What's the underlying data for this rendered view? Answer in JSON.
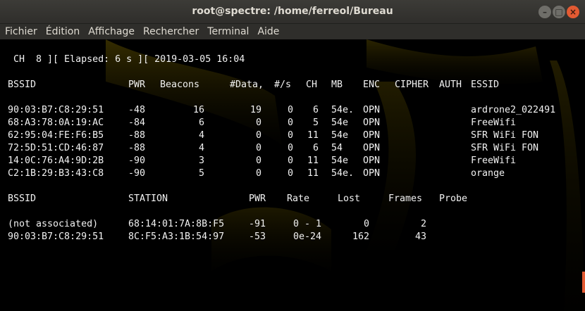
{
  "window": {
    "title": "root@spectre: /home/ferreol/Bureau",
    "buttons": {
      "minimize": "–",
      "maximize": "□",
      "close": "×"
    }
  },
  "menu": [
    "Fichier",
    "Édition",
    "Affichage",
    "Rechercher",
    "Terminal",
    "Aide"
  ],
  "terminal": {
    "status_line": " CH  8 ][ Elapsed: 6 s ][ 2019-03-05 16:04",
    "ap_headers": [
      "BSSID",
      "PWR",
      "Beacons",
      "#Data,",
      "#/s",
      "CH",
      "MB",
      "ENC",
      "CIPHER",
      "AUTH",
      "ESSID"
    ],
    "access_points": [
      {
        "bssid": "90:03:B7:C8:29:51",
        "pwr": "-48",
        "beacons": "16",
        "data": "19",
        "per_s": "0",
        "ch": "6",
        "mb": "54e.",
        "enc": "OPN",
        "cipher": "",
        "auth": "",
        "essid": "ardrone2_022491"
      },
      {
        "bssid": "68:A3:78:0A:19:AC",
        "pwr": "-84",
        "beacons": "6",
        "data": "0",
        "per_s": "0",
        "ch": "5",
        "mb": "54e",
        "enc": "OPN",
        "cipher": "",
        "auth": "",
        "essid": "FreeWifi"
      },
      {
        "bssid": "62:95:04:FE:F6:B5",
        "pwr": "-88",
        "beacons": "4",
        "data": "0",
        "per_s": "0",
        "ch": "11",
        "mb": "54e",
        "enc": "OPN",
        "cipher": "",
        "auth": "",
        "essid": "SFR WiFi FON"
      },
      {
        "bssid": "72:5D:51:CD:46:87",
        "pwr": "-88",
        "beacons": "4",
        "data": "0",
        "per_s": "0",
        "ch": "6",
        "mb": "54",
        "enc": "OPN",
        "cipher": "",
        "auth": "",
        "essid": "SFR WiFi FON"
      },
      {
        "bssid": "14:0C:76:A4:9D:2B",
        "pwr": "-90",
        "beacons": "3",
        "data": "0",
        "per_s": "0",
        "ch": "11",
        "mb": "54e",
        "enc": "OPN",
        "cipher": "",
        "auth": "",
        "essid": "FreeWifi"
      },
      {
        "bssid": "C2:1B:29:B3:43:C8",
        "pwr": "-90",
        "beacons": "5",
        "data": "0",
        "per_s": "0",
        "ch": "11",
        "mb": "54e.",
        "enc": "OPN",
        "cipher": "",
        "auth": "",
        "essid": "orange"
      }
    ],
    "station_headers": [
      "BSSID",
      "STATION",
      "PWR",
      "Rate",
      "Lost",
      "Frames",
      "Probe"
    ],
    "stations": [
      {
        "bssid": "(not associated)",
        "station": "68:14:01:7A:8B:F5",
        "pwr": "-91",
        "rate": "0 - 1",
        "lost": "0",
        "frames": "2",
        "probe": ""
      },
      {
        "bssid": "90:03:B7:C8:29:51",
        "station": "8C:F5:A3:1B:54:97",
        "pwr": "-53",
        "rate": "0e-24",
        "lost": "162",
        "frames": "43",
        "probe": ""
      }
    ]
  }
}
